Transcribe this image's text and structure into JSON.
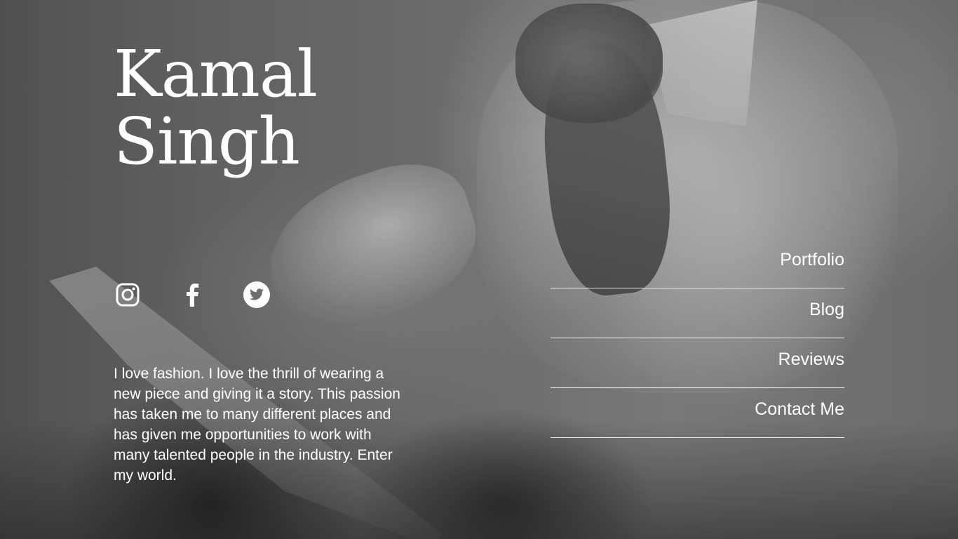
{
  "profile": {
    "first_name": "Kamal",
    "last_name": "Singh",
    "bio": "I love fashion. I love the thrill of wearing a new piece and giving it a story. This passion has taken me to many different places and has given me opportunities to work with many talented people in the industry. Enter my world."
  },
  "socials": [
    {
      "icon": "instagram-icon"
    },
    {
      "icon": "facebook-icon"
    },
    {
      "icon": "twitter-icon"
    }
  ],
  "nav": {
    "items": [
      {
        "label": "Portfolio"
      },
      {
        "label": "Blog"
      },
      {
        "label": "Reviews"
      },
      {
        "label": "Contact Me"
      }
    ]
  },
  "colors": {
    "text": "#ffffff",
    "background": "#6e6e6e",
    "divider": "#e6e6e6"
  }
}
